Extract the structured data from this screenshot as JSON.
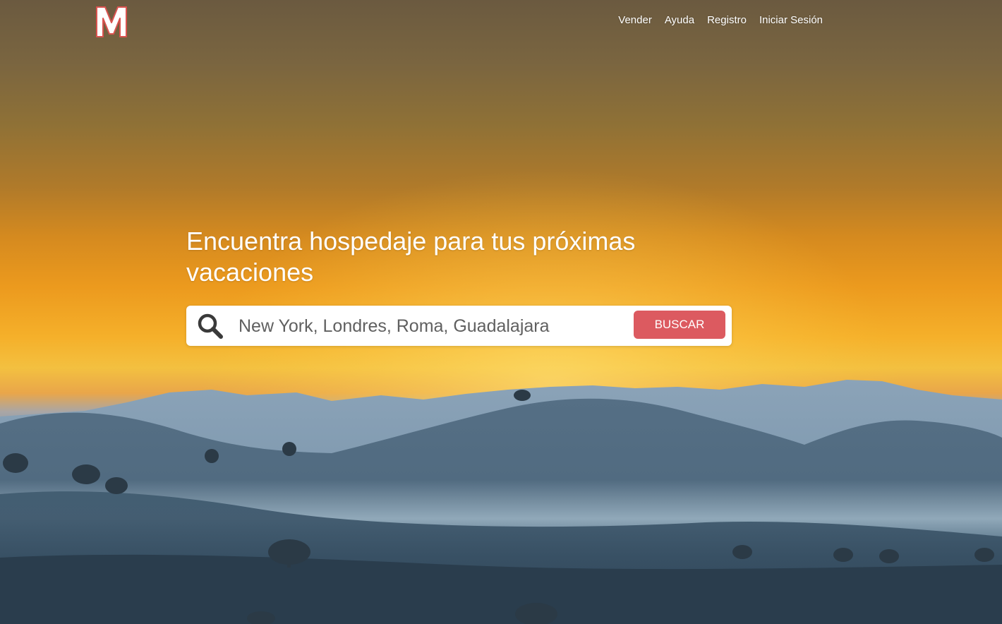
{
  "nav": {
    "items": [
      {
        "label": "Vender"
      },
      {
        "label": "Ayuda"
      },
      {
        "label": "Registro"
      },
      {
        "label": "Iniciar Sesión"
      }
    ]
  },
  "brand": {
    "logo_letter": "M",
    "logo_color": "#ffffff",
    "logo_outline_color": "#d9534f"
  },
  "hero": {
    "headline": "Encuentra hospedaje para tus próximas vacaciones"
  },
  "search": {
    "placeholder": "New York, Londres, Roma, Guadalajara",
    "value": "",
    "button_label": "BUSCAR",
    "button_color": "#dc5a60",
    "icon": "search-icon"
  }
}
